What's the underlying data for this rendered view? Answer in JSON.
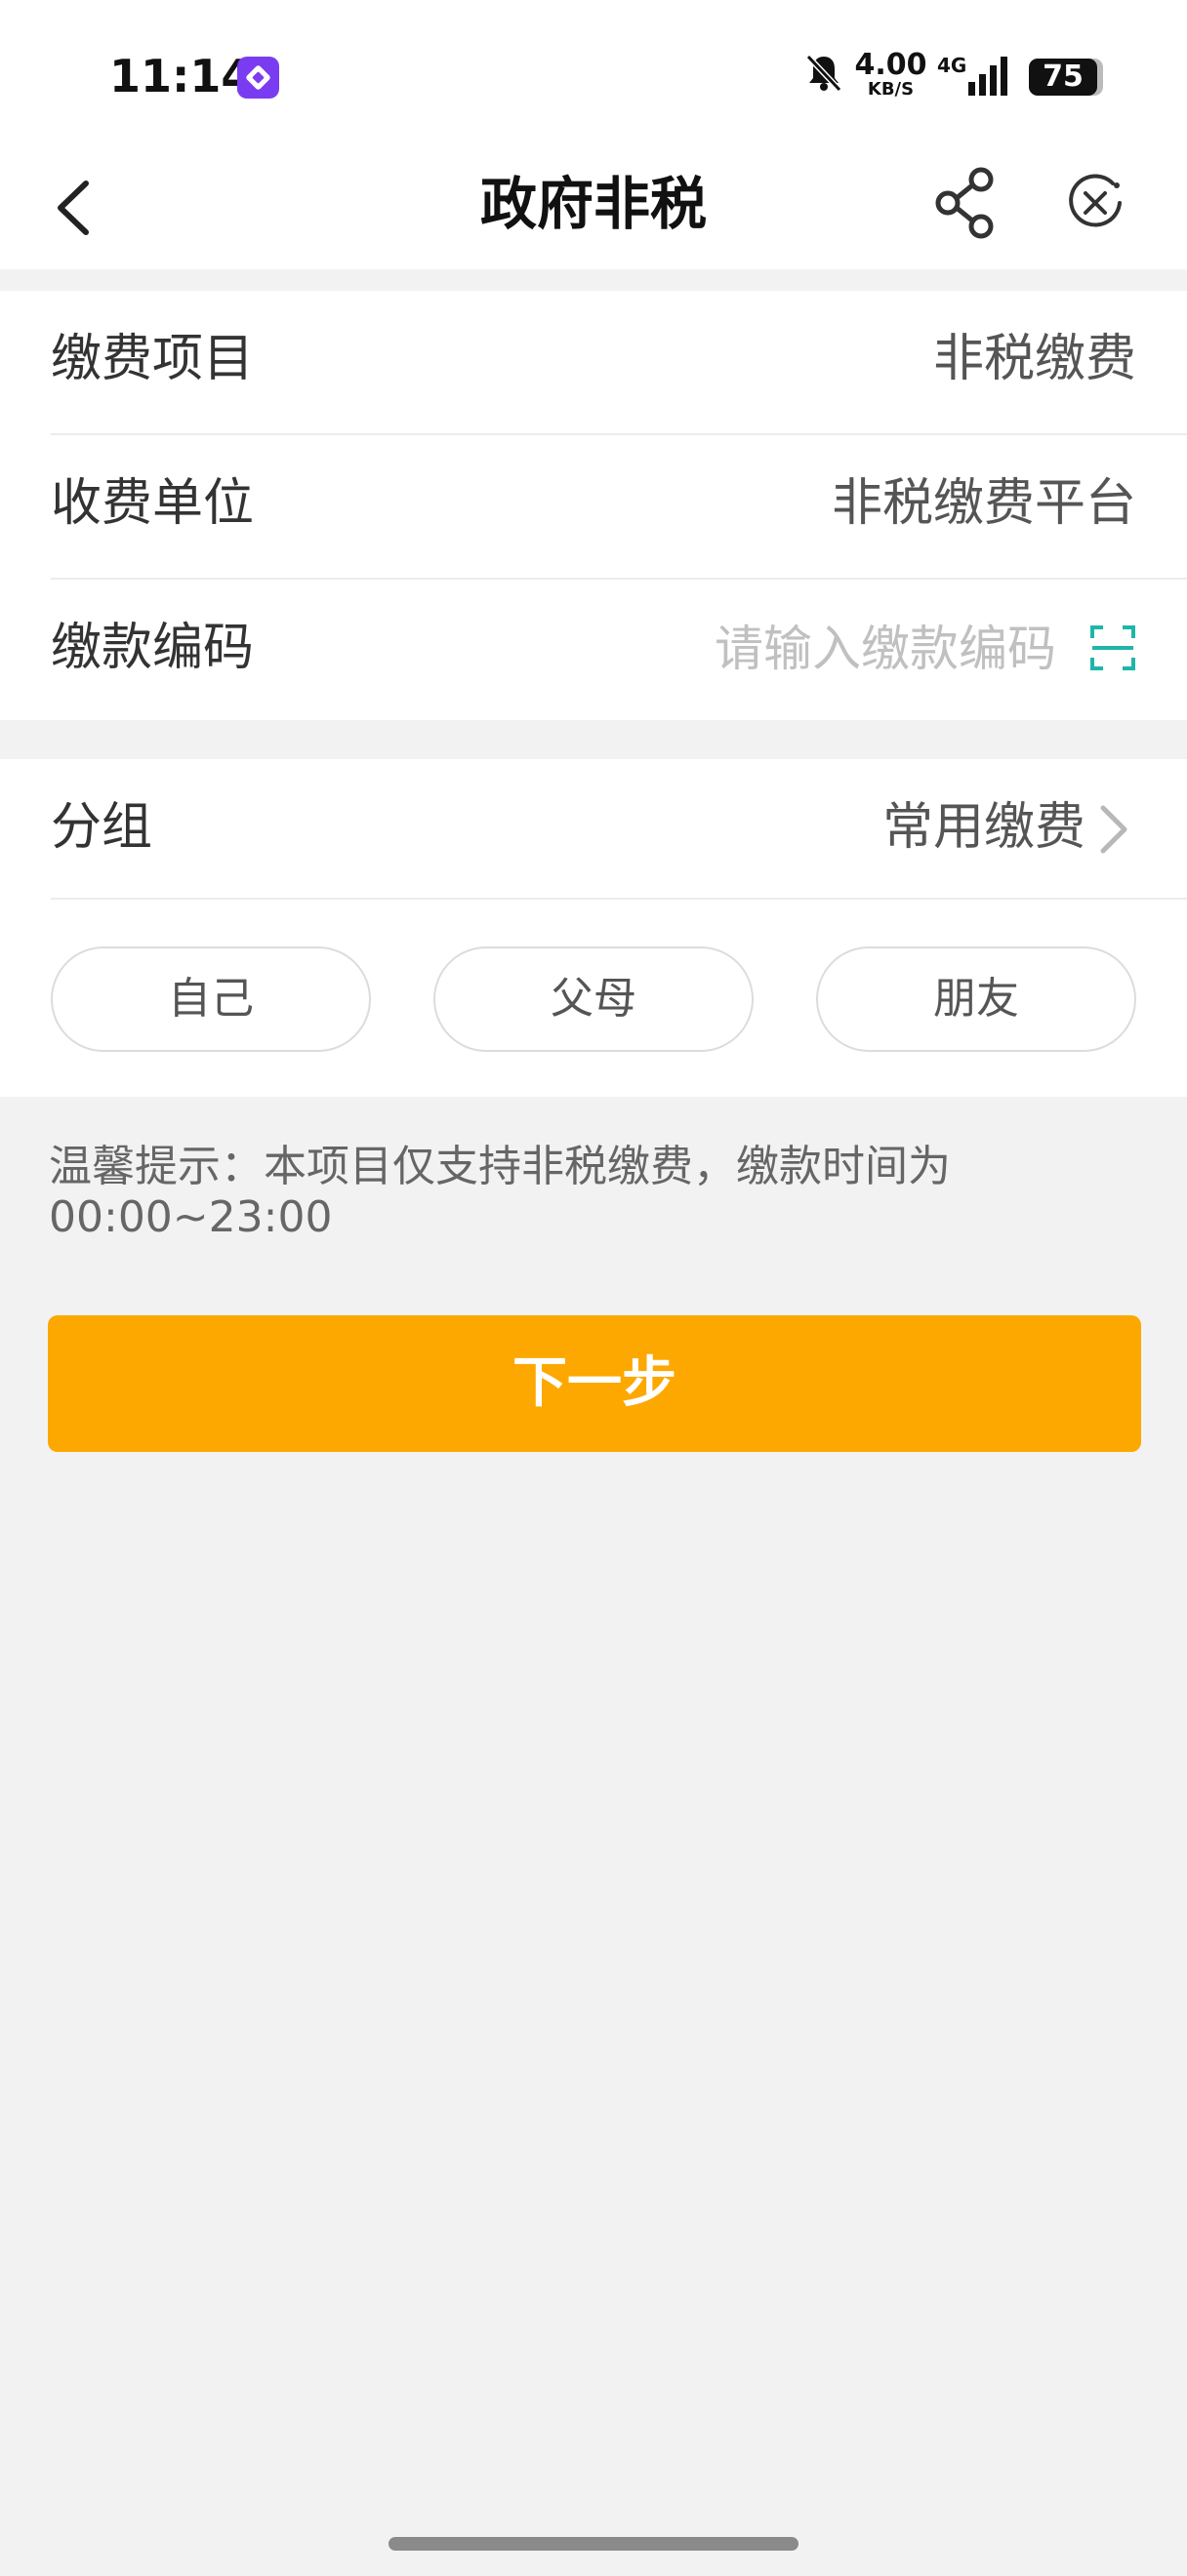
{
  "status_bar": {
    "time": "11:14",
    "net_speed_value": "4.00",
    "net_speed_unit": "KB/S",
    "network_type": "4G",
    "battery_level": "75",
    "icons": [
      "app-notification-icon",
      "mute-bell-icon",
      "signal-icon",
      "battery-icon"
    ]
  },
  "nav": {
    "title": "政府非税",
    "icons": [
      "back-arrow-icon",
      "share-icon",
      "close-mini-program-icon"
    ]
  },
  "form": {
    "rows": [
      {
        "label": "缴费项目",
        "value": "非税缴费"
      },
      {
        "label": "收费单位",
        "value": "非税缴费平台"
      },
      {
        "label": "缴款编码",
        "value": ""
      }
    ],
    "code_placeholder": "请输入缴款编码",
    "scan_icon": "scan-icon"
  },
  "group": {
    "label": "分组",
    "value": "常用缴费",
    "chips": [
      "自己",
      "父母",
      "朋友"
    ]
  },
  "tip": "温馨提示：本项目仅支持非税缴费，缴款时间为00:00~23:00",
  "next_button_label": "下一步",
  "colors": {
    "accent": "#fca800",
    "scan_icon": "#1fb6a8",
    "app_icon": "#7a3cf0",
    "background": "#f2f2f2"
  }
}
